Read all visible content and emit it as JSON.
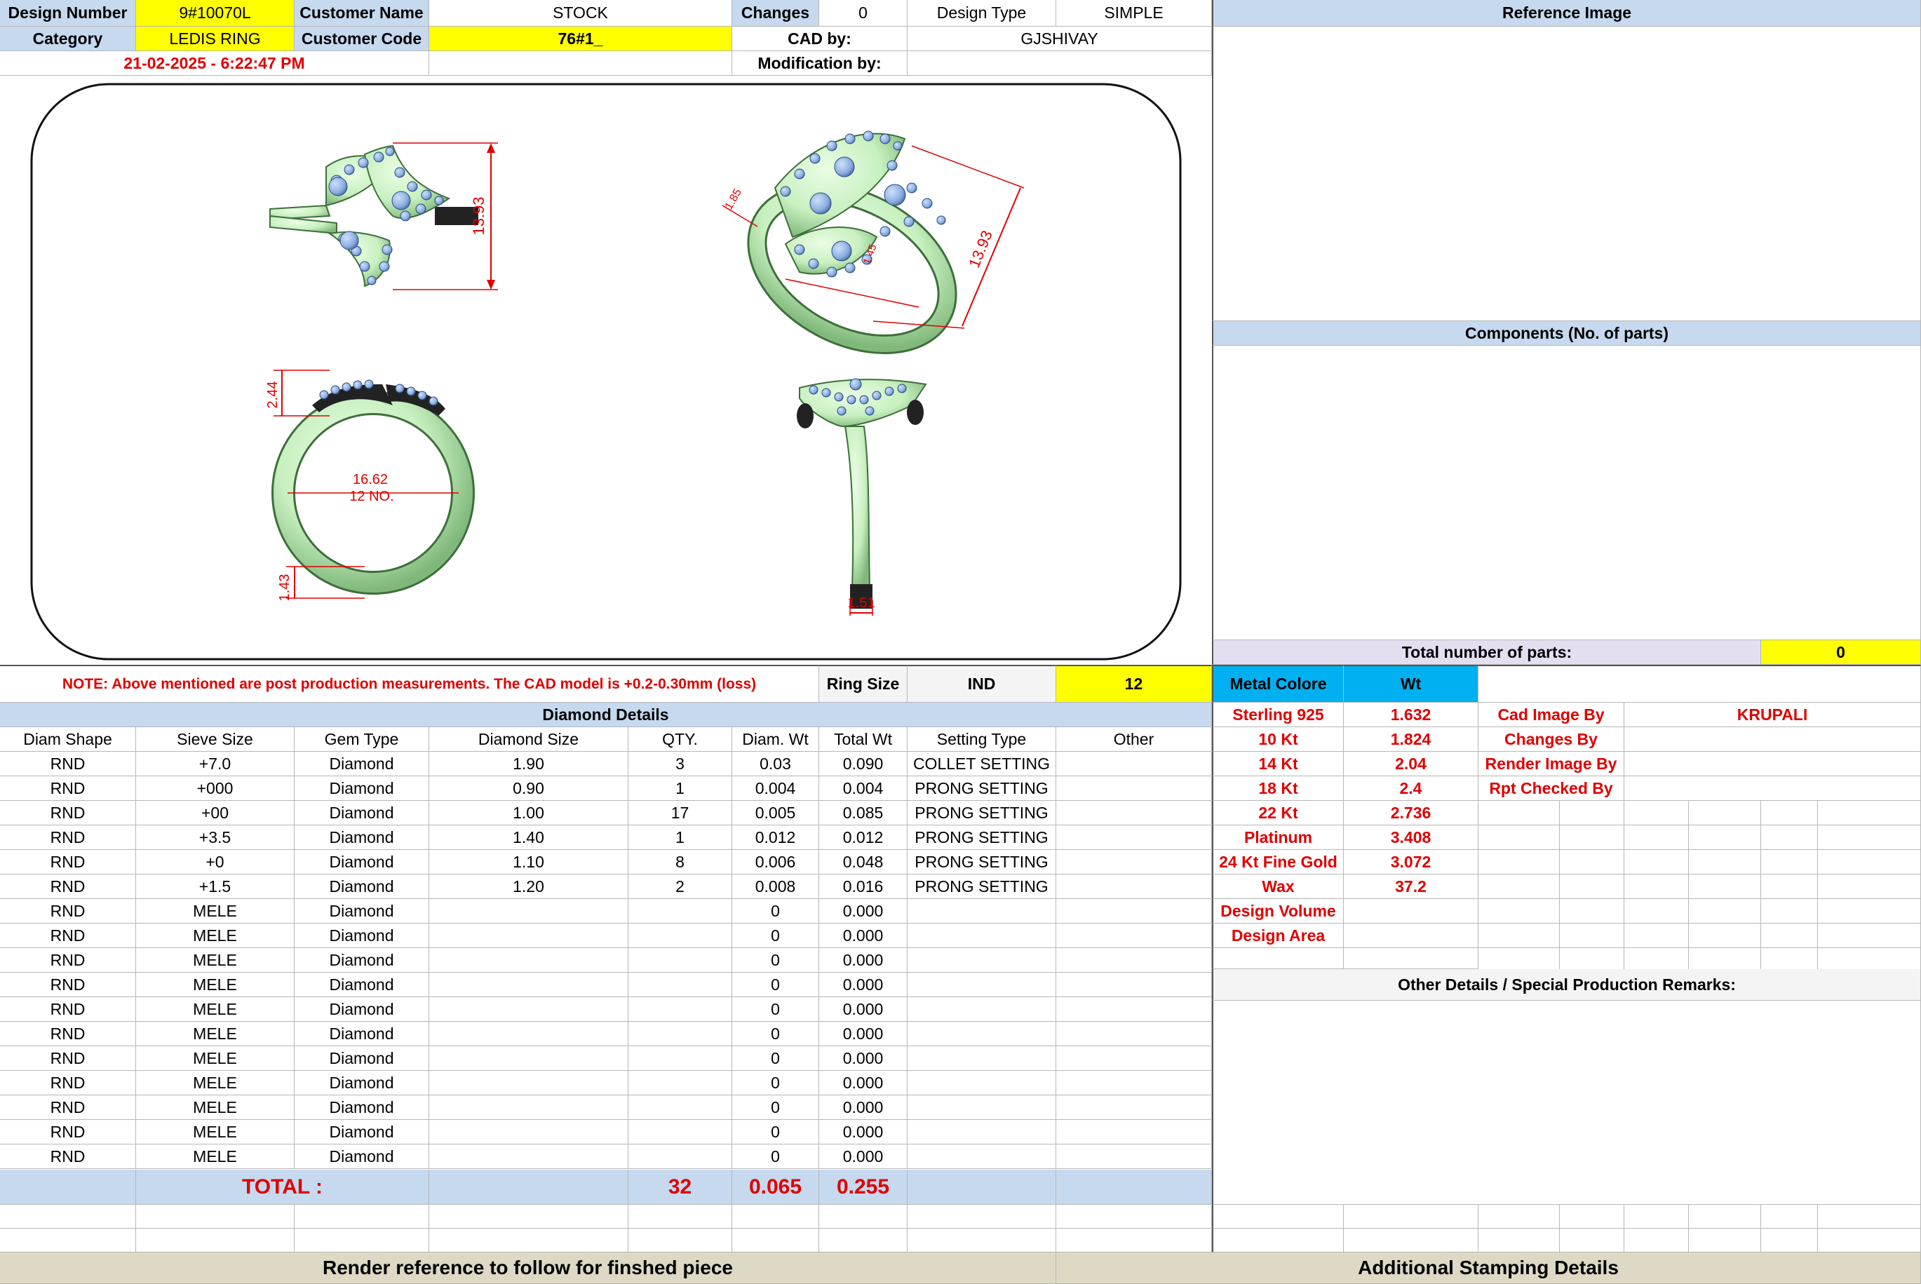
{
  "header": {
    "design_number_label": "Design Number",
    "design_number": "9#10070L",
    "customer_name_label": "Customer Name",
    "customer_name": "STOCK",
    "changes_label": "Changes",
    "changes": "0",
    "design_type_label": "Design Type",
    "design_type": "SIMPLE",
    "category_label": "Category",
    "category": "LEDIS RING",
    "customer_code_label": "Customer Code",
    "customer_code": "76#1_",
    "cad_by_label": "CAD by:",
    "cad_by": "GJSHIVAY",
    "timestamp": "21-02-2025 - 6:22:47 PM",
    "modification_by_label": "Modification by:"
  },
  "drawing": {
    "dim_top_height": "13.93",
    "dim_persp_height": "13.93",
    "dim_persp_small_a": "1.85",
    "dim_persp_small_b": "1.45",
    "dim_side_top": "2.44",
    "dim_side_inner": "16.62",
    "ring_size_no": "12 NO.",
    "dim_side_bottom": "1.43",
    "dim_front_bottom": "1.51"
  },
  "right_panel": {
    "reference_image_label": "Reference Image",
    "components_label": "Components (No. of parts)",
    "total_parts_label": "Total number of parts:",
    "total_parts": "0"
  },
  "note_row": {
    "note": "NOTE: Above mentioned are post production measurements. The CAD model is +0.2-0.30mm (loss)",
    "ring_size_label": "Ring Size",
    "ring_size_standard": "IND",
    "ring_size_value": "12"
  },
  "metal": {
    "col_label": "Metal Colore",
    "wt_label": "Wt",
    "rows": [
      {
        "name": "Sterling 925",
        "wt": "1.632"
      },
      {
        "name": "10 Kt",
        "wt": "1.824"
      },
      {
        "name": "14 Kt",
        "wt": "2.04"
      },
      {
        "name": "18 Kt",
        "wt": "2.4"
      },
      {
        "name": "22 Kt",
        "wt": "2.736"
      },
      {
        "name": "Platinum",
        "wt": "3.408"
      },
      {
        "name": "24 Kt Fine Gold",
        "wt": "3.072"
      },
      {
        "name": "Wax",
        "wt": "37.2"
      },
      {
        "name": "Design Volume",
        "wt": ""
      },
      {
        "name": "Design Area",
        "wt": ""
      }
    ]
  },
  "credits": [
    {
      "label": "Cad Image By",
      "value": "KRUPALI"
    },
    {
      "label": "Changes By",
      "value": ""
    },
    {
      "label": "Render Image By",
      "value": ""
    },
    {
      "label": "Rpt Checked By",
      "value": ""
    }
  ],
  "other_details_label": "Other Details / Special Production Remarks:",
  "diamond": {
    "title": "Diamond Details",
    "columns": [
      "Diam Shape",
      "Sieve Size",
      "Gem Type",
      "Diamond Size",
      "QTY.",
      "Diam. Wt",
      "Total Wt",
      "Setting Type",
      "Other"
    ],
    "rows": [
      [
        "RND",
        "+7.0",
        "Diamond",
        "1.90",
        "3",
        "0.03",
        "0.090",
        "COLLET SETTING",
        ""
      ],
      [
        "RND",
        "+000",
        "Diamond",
        "0.90",
        "1",
        "0.004",
        "0.004",
        "PRONG SETTING",
        ""
      ],
      [
        "RND",
        "+00",
        "Diamond",
        "1.00",
        "17",
        "0.005",
        "0.085",
        "PRONG SETTING",
        ""
      ],
      [
        "RND",
        "+3.5",
        "Diamond",
        "1.40",
        "1",
        "0.012",
        "0.012",
        "PRONG SETTING",
        ""
      ],
      [
        "RND",
        "+0",
        "Diamond",
        "1.10",
        "8",
        "0.006",
        "0.048",
        "PRONG SETTING",
        ""
      ],
      [
        "RND",
        "+1.5",
        "Diamond",
        "1.20",
        "2",
        "0.008",
        "0.016",
        "PRONG SETTING",
        ""
      ],
      [
        "RND",
        "MELE",
        "Diamond",
        "",
        "",
        "0",
        "0.000",
        "",
        ""
      ],
      [
        "RND",
        "MELE",
        "Diamond",
        "",
        "",
        "0",
        "0.000",
        "",
        ""
      ],
      [
        "RND",
        "MELE",
        "Diamond",
        "",
        "",
        "0",
        "0.000",
        "",
        ""
      ],
      [
        "RND",
        "MELE",
        "Diamond",
        "",
        "",
        "0",
        "0.000",
        "",
        ""
      ],
      [
        "RND",
        "MELE",
        "Diamond",
        "",
        "",
        "0",
        "0.000",
        "",
        ""
      ],
      [
        "RND",
        "MELE",
        "Diamond",
        "",
        "",
        "0",
        "0.000",
        "",
        ""
      ],
      [
        "RND",
        "MELE",
        "Diamond",
        "",
        "",
        "0",
        "0.000",
        "",
        ""
      ],
      [
        "RND",
        "MELE",
        "Diamond",
        "",
        "",
        "0",
        "0.000",
        "",
        ""
      ],
      [
        "RND",
        "MELE",
        "Diamond",
        "",
        "",
        "0",
        "0.000",
        "",
        ""
      ],
      [
        "RND",
        "MELE",
        "Diamond",
        "",
        "",
        "0",
        "0.000",
        "",
        ""
      ],
      [
        "RND",
        "MELE",
        "Diamond",
        "",
        "",
        "0",
        "0.000",
        "",
        ""
      ]
    ],
    "total_label": "TOTAL :",
    "total_qty": "32",
    "total_diam_wt": "0.065",
    "total_wt": "0.255"
  },
  "footer": {
    "render_reference": "Render reference to follow for finshed piece",
    "stamping": "Additional Stamping Details"
  },
  "colors": {
    "highlight_yellow": "#ffff00",
    "header_blue": "#c6d9ee",
    "metal_cyan": "#00b0f0",
    "label_red": "#e00000",
    "footer_tan": "#ddd9c4",
    "ring_metal": "#c8f0c0",
    "gem_blue": "#8aaee0"
  }
}
